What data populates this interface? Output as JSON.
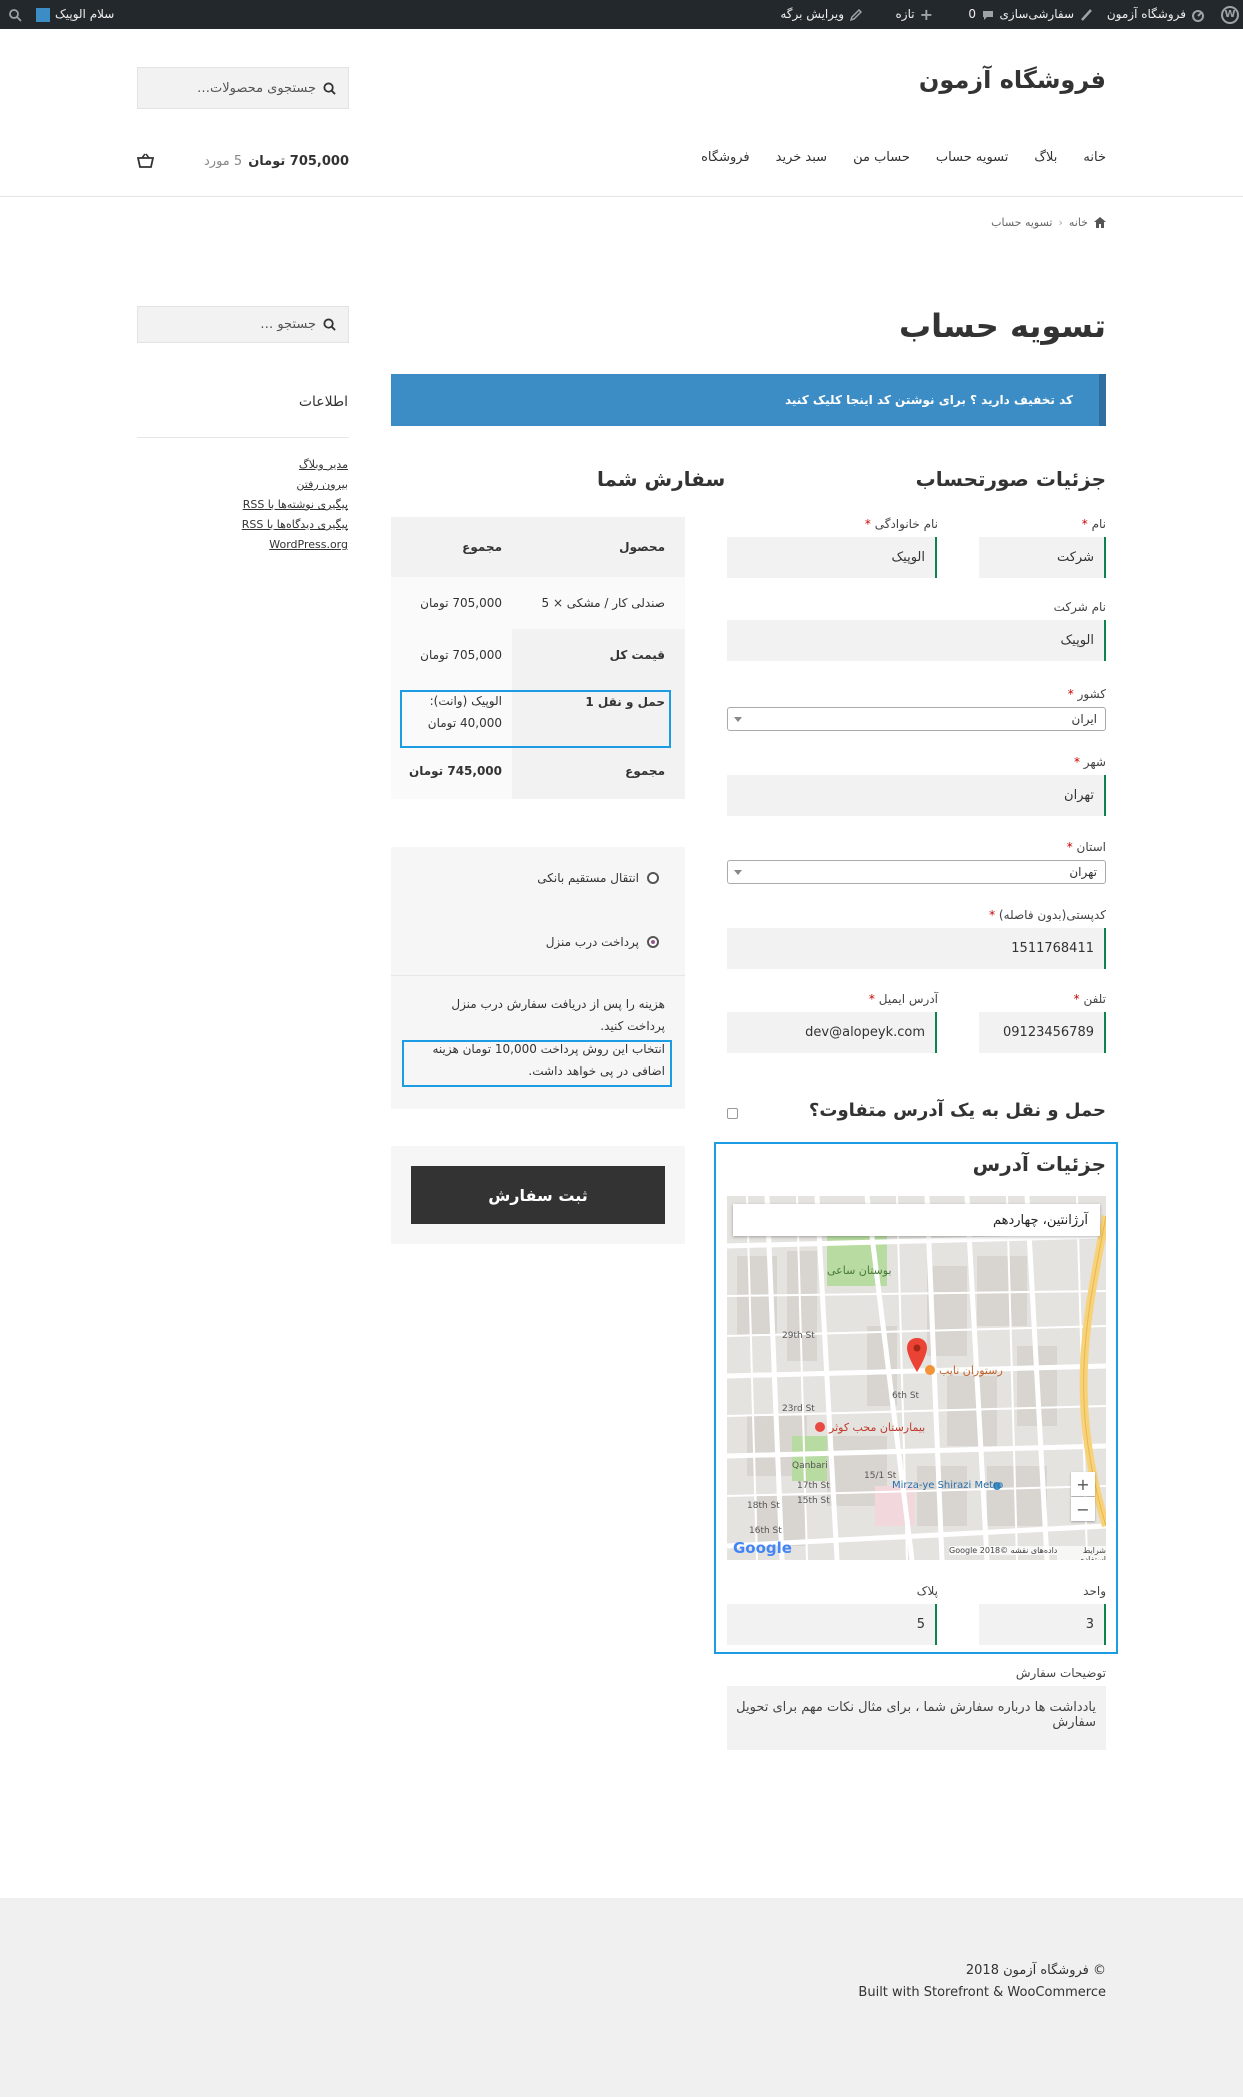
{
  "admin_bar": {
    "site_name": "فروشگاه آزمون",
    "customize": "سفارشی‌سازی",
    "comments_count": "0",
    "new": "تازه",
    "edit_page": "ویرایش برگه",
    "greeting": "سلام الوپیک"
  },
  "header": {
    "site_title": "فروشگاه آزمون",
    "search_placeholder": "جستجوی محصولات…",
    "nav": [
      "خانه",
      "بلاگ",
      "تسویه حساب",
      "حساب من",
      "سبد خرید",
      "فروشگاه"
    ],
    "cart_total": "705,000 تومان",
    "cart_count": "5 مورد"
  },
  "breadcrumb": {
    "home": "خانه",
    "current": "تسویه حساب"
  },
  "page_title": "تسویه حساب",
  "coupon_notice": "کد تخفیف دارید ؟ برای نوشتن کد اینجا کلیک کنید",
  "billing": {
    "heading": "جزئیات صورتحساب",
    "first_name_label": "نام",
    "first_name_value": "شرکت",
    "last_name_label": "نام خانوادگی",
    "last_name_value": "الوپیک",
    "company_label": "نام شرکت",
    "company_value": "الوپیک",
    "country_label": "کشور",
    "country_value": "ایران",
    "city_label": "شهر",
    "city_value": "تهران",
    "state_label": "استان",
    "state_value": "تهران",
    "postcode_label": "کدپستی(بدون فاصله)",
    "postcode_value": "1511768411",
    "phone_label": "تلفن",
    "phone_value": "09123456789",
    "email_label": "آدرس ایمیل",
    "email_value": "dev@alopeyk.com",
    "required_mark": "*"
  },
  "ship_different": {
    "label": "حمل و نقل به یک آدرس متفاوت؟"
  },
  "address_details": {
    "heading": "جزئیات آدرس",
    "map_search_value": "آرژانتین، چهاردهم",
    "map_labels": [
      "بوستان ساعی",
      "رستوران نایب",
      "بیمارستان محب کوثر",
      "Mirza-ye Shirazi Metro",
      "29th St",
      "23rd St",
      "17th St",
      "15th St",
      "18th St",
      "16th St",
      "Qanbari",
      "15/1 St",
      "6th St"
    ],
    "map_credit": "داده‌های نقشه ©2018 Google",
    "map_terms": "شرایط استفاده",
    "google_logo": "Google",
    "zoom_in": "+",
    "zoom_out": "−",
    "unit_label": "واحد",
    "unit_value": "3",
    "plaque_label": "پلاک",
    "plaque_value": "5"
  },
  "order_notes": {
    "label": "توضیحات سفارش",
    "placeholder": "یادداشت ها درباره سفارش شما ، برای مثال نکات مهم برای تحویل سفارش"
  },
  "order_review": {
    "heading": "سفارش شما",
    "col_product": "محصول",
    "col_total": "مجموع",
    "item_name": "صندلی کار / مشکی × 5",
    "item_total": "705,000 تومان",
    "subtotal_label": "قیمت کل",
    "subtotal_value": "705,000 تومان",
    "shipping_label": "حمل و نقل 1",
    "shipping_method": "الوپیک (وانت):",
    "shipping_value": "40,000 تومان",
    "total_label": "مجموع",
    "total_value": "745,000 تومان"
  },
  "payment": {
    "option_bank": "انتقال مستقیم بانکی",
    "option_cod": "پرداخت درب منزل",
    "cod_desc": "هزینه را پس از دریافت سفارش درب منزل پرداخت کنید.",
    "cod_note": "انتخاب این روش پرداخت 10,000 تومان هزینه اضافی در پی خواهد داشت.",
    "place_order": "ثبت سفارش"
  },
  "sidebar": {
    "search_placeholder": "جستجو …",
    "meta_heading": "اطلاعات",
    "links": [
      "مدیر وبلاگ",
      "بیرون رفتن",
      "پیگیری نوشته‌ها با RSS",
      "پیگیری دیدگاه‌ها با RSS",
      "WordPress.org"
    ]
  },
  "footer": {
    "copyright": "© فروشگاه آزمون 2018",
    "built_with": "Built with Storefront & WooCommerce"
  },
  "colors": {
    "admin_bar_bg": "#23282d",
    "notice_blue": "#3c8dc5",
    "highlight_border": "#1b9ce3",
    "input_accent": "#0f834d",
    "button_dark": "#333333",
    "footer_bg": "#f0f0f0"
  }
}
